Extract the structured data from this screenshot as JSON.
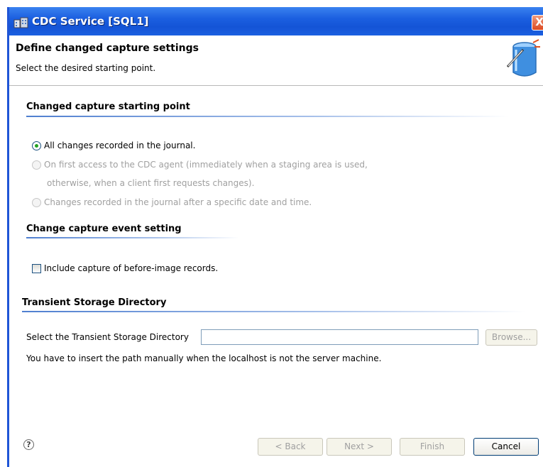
{
  "window": {
    "title": "CDC Service [SQL1]",
    "close_glyph": "X"
  },
  "header": {
    "title": "Define changed capture settings",
    "subtitle": "Select the desired starting point."
  },
  "sections": {
    "starting_point": {
      "title": "Changed capture starting point",
      "options": [
        {
          "label": "All changes recorded in the journal.",
          "checked": true,
          "enabled": true
        },
        {
          "label": "On first access to the CDC agent (immediately when a staging area is used,",
          "label_line2": "otherwise, when a client first requests changes).",
          "checked": false,
          "enabled": false
        },
        {
          "label": "Changes recorded in the journal after a specific date and time.",
          "checked": false,
          "enabled": false
        }
      ]
    },
    "event_setting": {
      "title": "Change capture event setting",
      "checkbox_label": "Include capture of before-image records.",
      "checked": false
    },
    "transient": {
      "title": "Transient Storage Directory",
      "field_label": "Select the Transient Storage Directory",
      "field_value": "",
      "browse_label": "Browse...",
      "note": "You have to insert the path manually when the localhost is not the server machine."
    }
  },
  "footer": {
    "help_glyph": "?",
    "back_label": "< Back",
    "next_label": "Next >",
    "finish_label": "Finish",
    "cancel_label": "Cancel"
  },
  "colors": {
    "titlebar": "#1b5fe0",
    "section_line": "#4f7fd0",
    "radio_dot": "#21a121"
  }
}
